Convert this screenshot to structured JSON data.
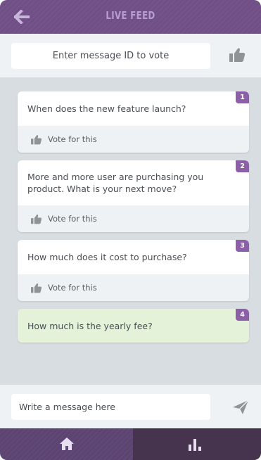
{
  "header": {
    "title": "LIVE FEED",
    "back_icon": "arrow-left-icon"
  },
  "vote": {
    "placeholder": "Enter message ID to vote",
    "button_icon": "thumbs-up-icon"
  },
  "messages": [
    {
      "id": "1",
      "text": "When does the new feature launch?",
      "vote_label": "Vote for this",
      "highlighted": false
    },
    {
      "id": "2",
      "text": "More and more user are purchasing you product. What is your next move?",
      "vote_label": "Vote for this",
      "highlighted": false
    },
    {
      "id": "3",
      "text": "How much does it cost to purchase?",
      "vote_label": "Vote for this",
      "highlighted": false
    },
    {
      "id": "4",
      "text": "How much is the yearly fee?",
      "highlighted": true
    }
  ],
  "compose": {
    "placeholder": "Write a message here",
    "send_icon": "send-icon"
  },
  "nav": {
    "home_icon": "home-icon",
    "stats_icon": "bar-chart-icon"
  },
  "colors": {
    "header": "#704e86",
    "badge": "#8c5fa8",
    "highlight_card": "#e3f2d9",
    "nav_active": "#5c4371",
    "nav_inactive": "#46344f"
  }
}
